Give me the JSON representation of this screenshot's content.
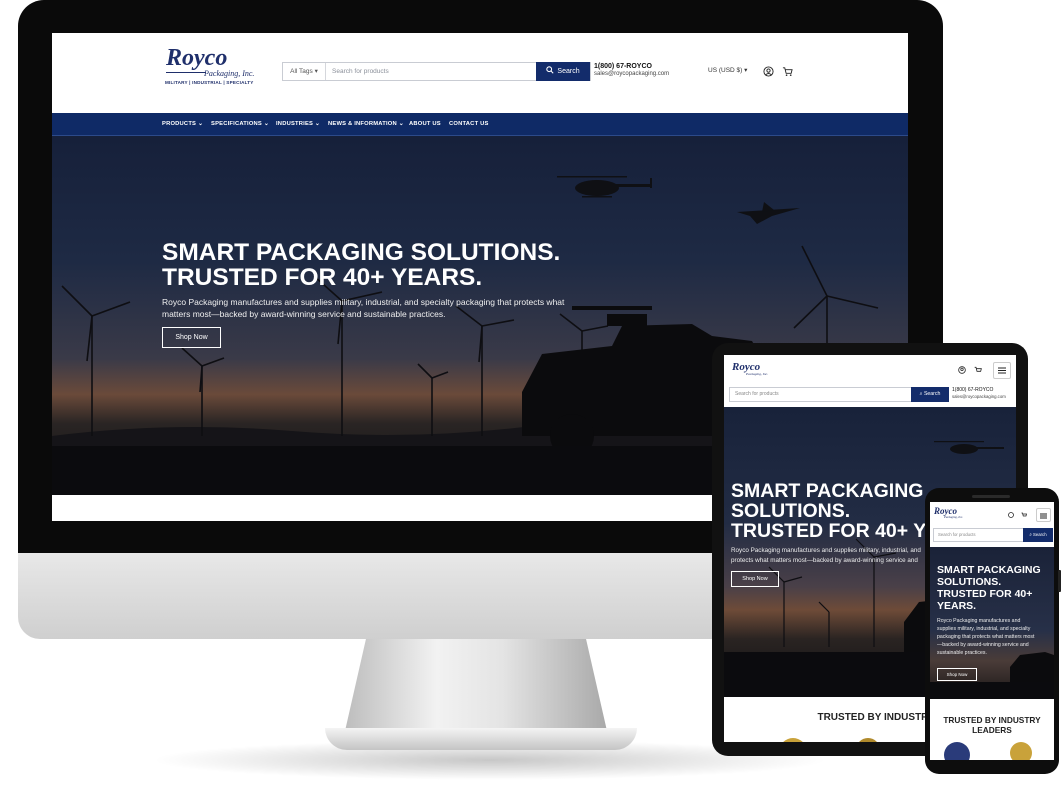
{
  "brand": {
    "logo_name": "Royco",
    "logo_sub": "Packaging, Inc.",
    "logo_tag": "MILITARY | INDUSTRIAL | SPECIALTY",
    "navy": "#0f2a66",
    "button_navy": "#132c6b"
  },
  "header": {
    "tags_label": "All Tags",
    "search_placeholder": "Search for products",
    "search_button": "Search",
    "phone": "1(800) 67-ROYCO",
    "email": "sales@roycopackaging.com",
    "currency": "US (USD $)",
    "icons": [
      "user-icon",
      "cart-icon",
      "search-icon",
      "menu-icon"
    ]
  },
  "nav": {
    "items": [
      "PRODUCTS",
      "SPECIFICATIONS",
      "INDUSTRIES",
      "NEWS & INFORMATION",
      "ABOUT US",
      "CONTACT US"
    ]
  },
  "hero": {
    "headline_line1": "SMART PACKAGING SOLUTIONS.",
    "headline_line2": "TRUSTED FOR 40+ YEARS.",
    "body_line1": "Royco Packaging manufactures and supplies military, industrial, and specialty packaging that protects what",
    "body_line2": "matters most—backed by award-winning service and sustainable practices.",
    "cta": "Shop Now"
  },
  "tablet": {
    "headline_line1": "SMART PACKAGING",
    "headline_line2": "SOLUTIONS.",
    "headline_line3": "TRUSTED FOR 40+ YE",
    "body_line1": "Royco Packaging manufactures and supplies military, industrial, and",
    "body_line2": "protects what matters most—backed by award-winning service and",
    "trusted": "TRUSTED BY INDUSTRY LEAD"
  },
  "phone_view": {
    "headline": "SMART PACKAGING SOLUTIONS. TRUSTED FOR 40+ YEARS.",
    "body": "Royco Packaging manufactures and supplies military, industrial, and specialty packaging that protects what matters most—backed by award-winning service and sustainable practices.",
    "trusted": "TRUSTED BY INDUSTRY LEADERS"
  }
}
